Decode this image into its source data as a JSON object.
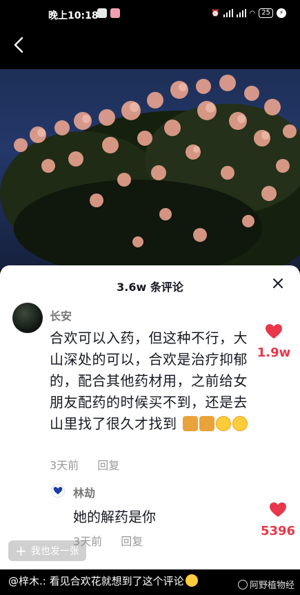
{
  "status": {
    "time": "晚上10:18",
    "battery": "25"
  },
  "sheet": {
    "title": "3.6w 条评论"
  },
  "comment": {
    "user": "长安",
    "text": "合欢可以入药，但这种不行，大山深处的可以，合欢是治疗抑郁的，配合其他药材用，之前给女朋友配药的时候买不到，还是去山里找了很久才找到",
    "time": "3天前",
    "reply_label": "回复",
    "likes": "1.9w"
  },
  "reply": {
    "user": "林劫",
    "text": "她的解药是你",
    "time": "3天前",
    "reply_label": "回复",
    "likes": "5396"
  },
  "send_label": "我也发一张",
  "caption": "@梓木.: 看见合欢花就想到了这个评论",
  "watermark": "阿野植物经",
  "colors": {
    "accent": "#e8374a",
    "text": "#161823",
    "muted": "#999999"
  }
}
